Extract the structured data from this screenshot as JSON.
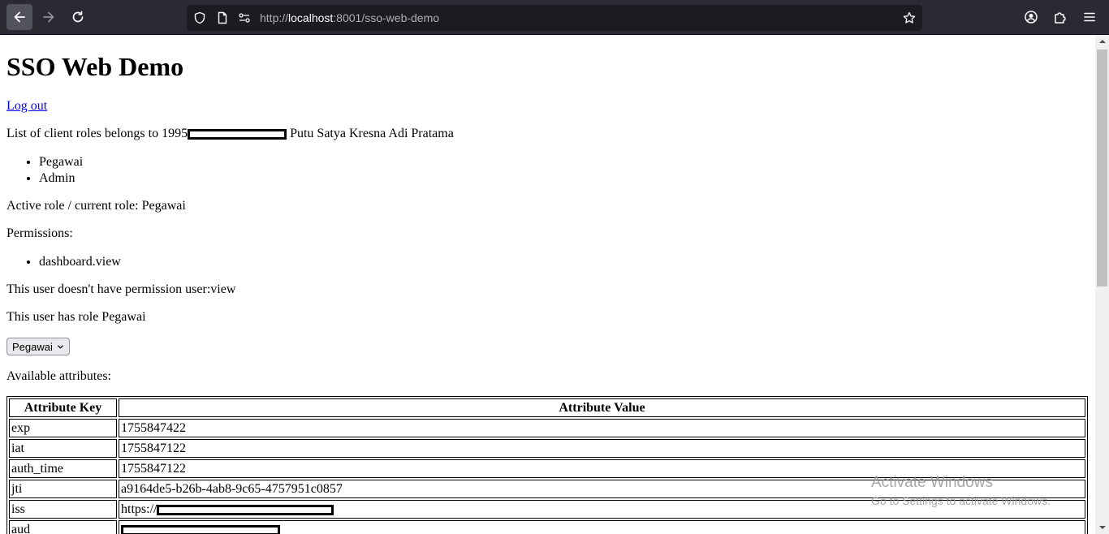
{
  "browser": {
    "url_prefix": "http://",
    "url_host": "localhost",
    "url_rest": ":8001/sso-web-demo",
    "icons": {
      "back": "arrow-left-icon",
      "forward": "arrow-right-icon",
      "reload": "reload-icon",
      "tracking": "shield-icon",
      "page": "page-icon",
      "permissions": "permissions-icon",
      "bookmark": "star-icon",
      "account": "account-icon",
      "extensions": "puzzle-icon",
      "menu": "hamburger-menu-icon"
    }
  },
  "page": {
    "title": "SSO Web Demo",
    "logout_label": "Log out",
    "roles_intro_prefix": "List of client roles belongs to 1995",
    "roles_intro_suffix": " Putu Satya Kresna Adi Pratama",
    "roles": [
      "Pegawai",
      "Admin"
    ],
    "active_role_text": "Active role / current role: Pegawai",
    "permissions_label": "Permissions:",
    "permissions": [
      "dashboard.view"
    ],
    "no_permission_text": "This user doesn't have permission user:view",
    "has_role_text": "This user has role Pegawai",
    "role_select_value": "Pegawai",
    "attributes_label": "Available attributes:",
    "table": {
      "headers": [
        "Attribute Key",
        "Attribute Value"
      ],
      "rows": [
        {
          "key": "exp",
          "value": "1755847422"
        },
        {
          "key": "iat",
          "value": "1755847122"
        },
        {
          "key": "auth_time",
          "value": "1755847122"
        },
        {
          "key": "jti",
          "value": "a9164de5-b26b-4ab8-9c65-4757951c0857"
        },
        {
          "key": "iss",
          "value": "https://"
        },
        {
          "key": "aud",
          "value": ""
        }
      ]
    }
  },
  "watermark": {
    "title": "Activate Windows",
    "subtitle": "Go to Settings to activate Windows."
  },
  "colors": {
    "toolbar_bg": "#2b2a33",
    "urlbar_bg": "#1c1b22",
    "link": "#0000ee"
  }
}
